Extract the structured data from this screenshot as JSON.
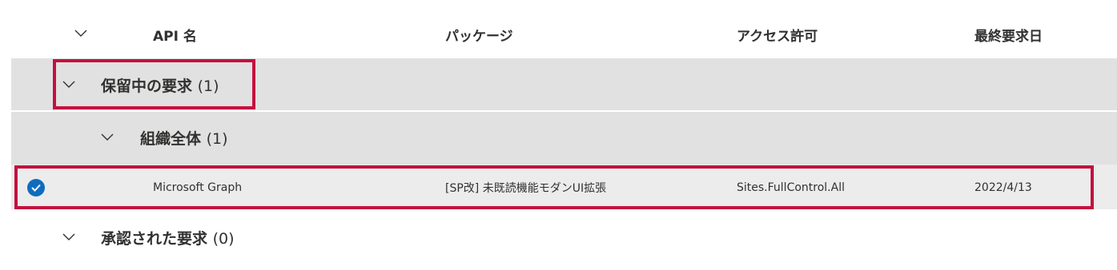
{
  "columns": {
    "api_name": "API 名",
    "package": "パッケージ",
    "access": "アクセス許可",
    "last_requested": "最終要求日"
  },
  "groups": {
    "pending": {
      "title": "保留中の要求",
      "count": "(1)"
    },
    "org_wide": {
      "title": "組織全体",
      "count": "(1)"
    },
    "approved": {
      "title": "承認された要求",
      "count": "(0)"
    }
  },
  "row": {
    "api_name": "Microsoft Graph",
    "package": "[SP改] 未既読機能モダンUI拡張",
    "access": "Sites.FullControl.All",
    "date": "2022/4/13"
  },
  "colors": {
    "highlight": "#c4103f",
    "band": "#e1e1e1",
    "check": "#0f6cbd"
  }
}
